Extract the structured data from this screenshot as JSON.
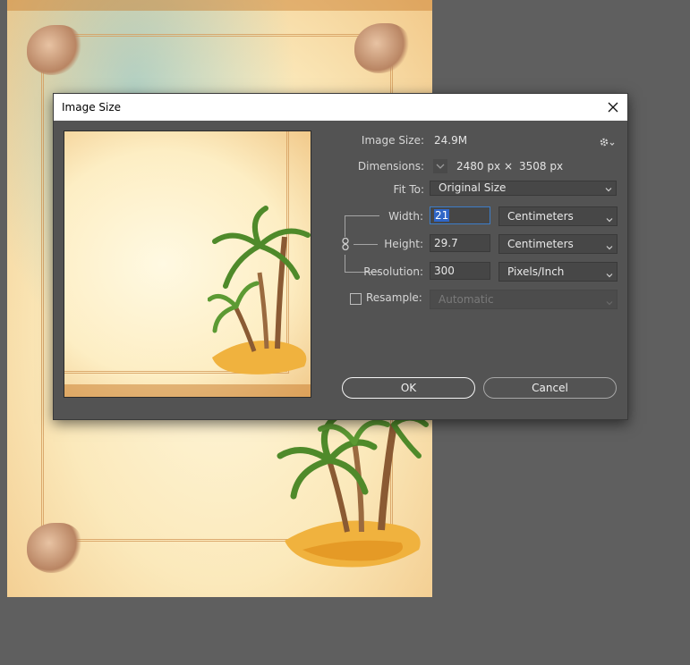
{
  "dialog": {
    "title": "Image Size",
    "image_size_label": "Image Size:",
    "image_size_value": "24.9M",
    "dimensions_label": "Dimensions:",
    "dimensions_width": "2480 px",
    "dimensions_times": "×",
    "dimensions_height": "3508 px",
    "fit_to_label": "Fit To:",
    "fit_to_value": "Original Size",
    "width_label": "Width:",
    "width_value": "21",
    "width_unit": "Centimeters",
    "height_label": "Height:",
    "height_value": "29.7",
    "height_unit": "Centimeters",
    "resolution_label": "Resolution:",
    "resolution_value": "300",
    "resolution_unit": "Pixels/Inch",
    "resample_label": "Resample:",
    "resample_checked": false,
    "resample_value": "Automatic",
    "ok_label": "OK",
    "cancel_label": "Cancel"
  },
  "icons": {
    "close": "close-icon",
    "settings": "gear-icon",
    "dimensions_toggle": "chevron-down-icon",
    "constrain": "chain-link-icon"
  },
  "colors": {
    "dialog_bg": "#535353",
    "workspace_bg": "#5f5f5f",
    "field_focus": "#3d7dc8",
    "selection": "#2f66c7"
  }
}
